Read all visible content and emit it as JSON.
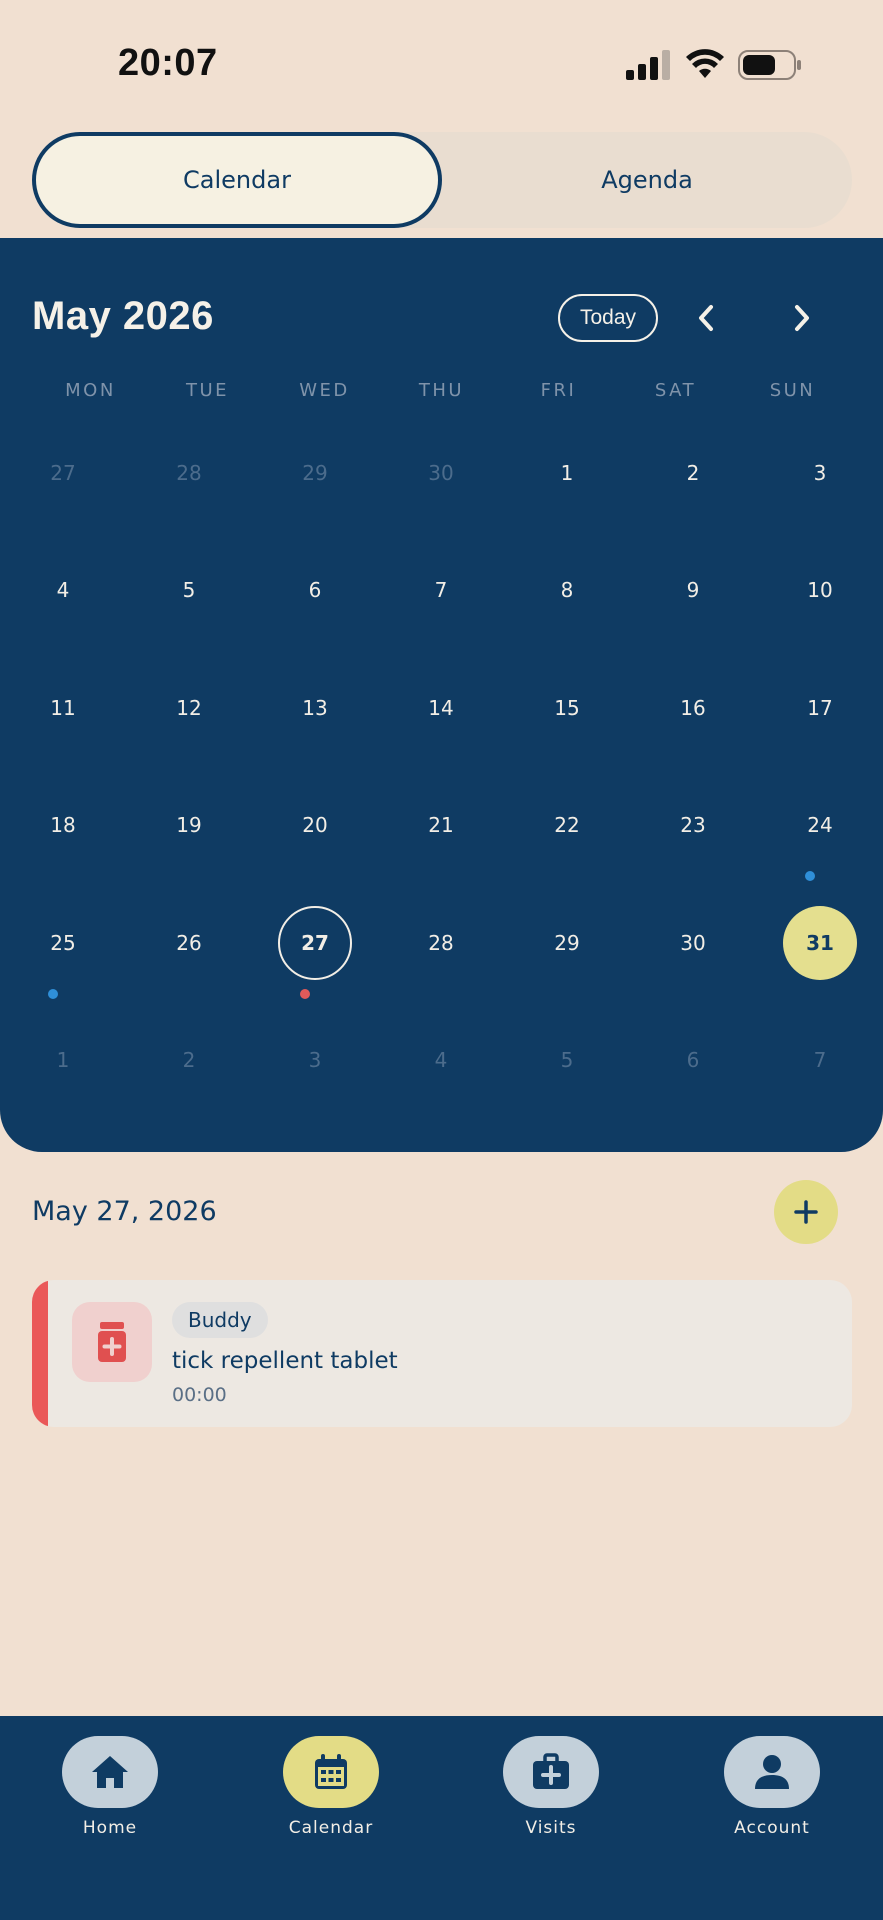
{
  "status_bar": {
    "time": "20:07"
  },
  "tabs": [
    {
      "label": "Calendar",
      "active": true
    },
    {
      "label": "Agenda",
      "active": false
    }
  ],
  "calendar": {
    "month_label": "May 2026",
    "today_label": "Today",
    "weekdays": [
      "MON",
      "TUE",
      "WED",
      "THU",
      "FRI",
      "SAT",
      "SUN"
    ],
    "weeks": [
      [
        "27",
        "28",
        "29",
        "30",
        "1",
        "2",
        "3"
      ],
      [
        "4",
        "5",
        "6",
        "7",
        "8",
        "9",
        "10"
      ],
      [
        "11",
        "12",
        "13",
        "14",
        "15",
        "16",
        "17"
      ],
      [
        "18",
        "19",
        "20",
        "21",
        "22",
        "23",
        "24"
      ],
      [
        "25",
        "26",
        "27",
        "28",
        "29",
        "30",
        "31"
      ],
      [
        "1",
        "2",
        "3",
        "4",
        "5",
        "6",
        "7"
      ]
    ],
    "today": "27",
    "selected": "31",
    "events_on": [
      {
        "day": "24",
        "color": "#2f8fd8"
      },
      {
        "day": "25",
        "color": "#2f8fd8"
      },
      {
        "day": "27",
        "color": "#e05a5a"
      }
    ]
  },
  "selected_date_label": "May 27, 2026",
  "events": [
    {
      "pet": "Buddy",
      "title": "tick repellent tablet",
      "time": "00:00",
      "icon": "medication-icon",
      "accent_color": "#ea5858"
    }
  ],
  "bottom_nav": [
    {
      "label": "Home",
      "icon": "home-icon",
      "active": false
    },
    {
      "label": "Calendar",
      "icon": "calendar-icon",
      "active": true
    },
    {
      "label": "Visits",
      "icon": "medical-kit-icon",
      "active": false
    },
    {
      "label": "Account",
      "icon": "user-icon",
      "active": false
    }
  ],
  "colors": {
    "background": "#f1e0d1",
    "primary": "#0f3b63",
    "accent": "#e3dc86",
    "event_blue": "#2f8fd8",
    "event_red": "#ea5858"
  }
}
